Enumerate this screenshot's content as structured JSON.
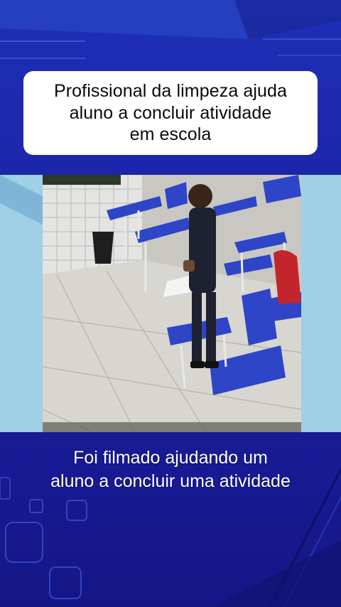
{
  "headline": {
    "lines": [
      "Profissional da limpeza ajuda",
      "aluno a concluir atividade",
      "em escola"
    ]
  },
  "video": {
    "scene": "classroom-cctv-still"
  },
  "caption": {
    "lines": [
      "Foi filmado ajudando um",
      "aluno a concluir uma atividade"
    ]
  },
  "colors": {
    "background": "#1a1fa0",
    "card": "#ffffff",
    "accent_light": "#8fc7df",
    "desk_blue": "#2e45c8"
  }
}
